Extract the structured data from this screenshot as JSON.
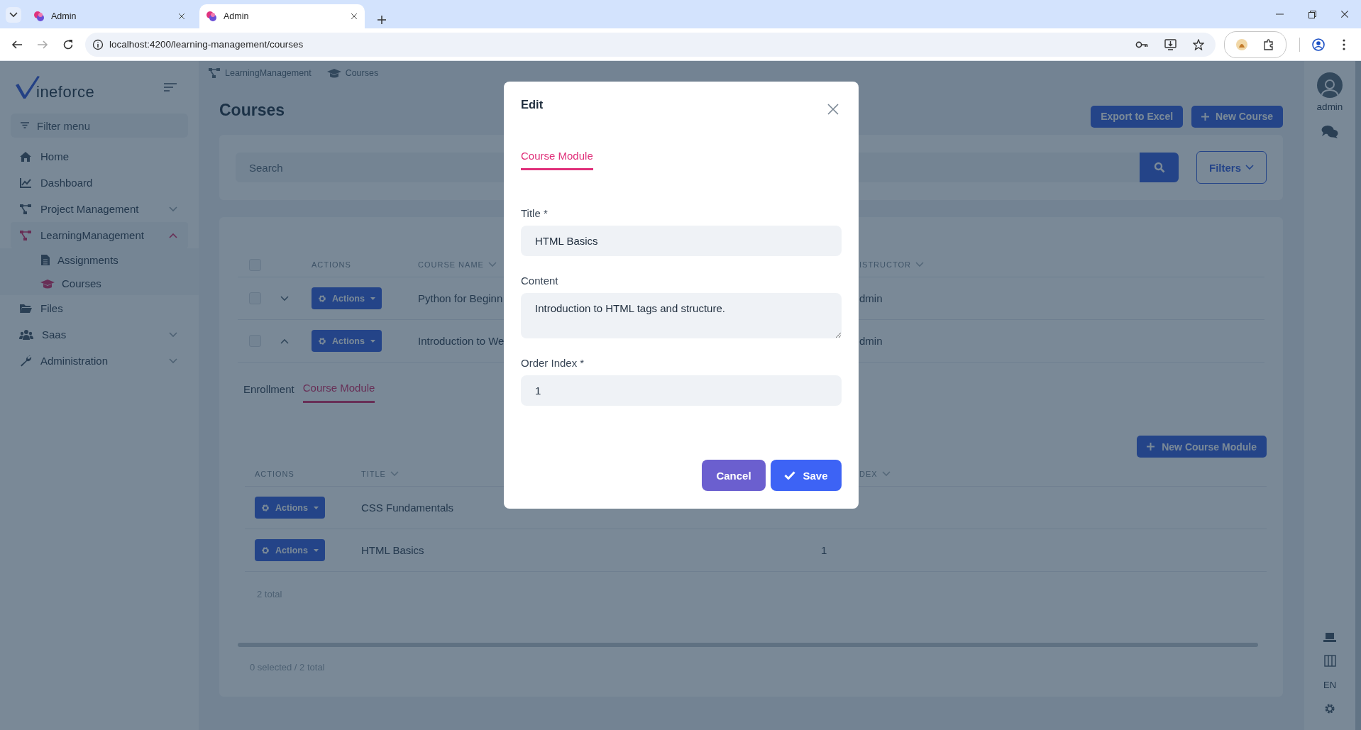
{
  "browser": {
    "tabs": [
      {
        "title": "Admin",
        "selected": false
      },
      {
        "title": "Admin",
        "selected": true
      }
    ],
    "url": "localhost:4200/learning-management/courses"
  },
  "sidebar": {
    "logo": "ineforce",
    "filter_placeholder": "Filter menu",
    "items": [
      {
        "label": "Home",
        "selected": false
      },
      {
        "label": "Dashboard",
        "selected": false
      },
      {
        "label": "Project Management",
        "selected": false,
        "expanded": false
      },
      {
        "label": "LearningManagement",
        "selected": true,
        "expanded": true,
        "children": [
          {
            "label": "Assignments",
            "selected": false
          },
          {
            "label": "Courses",
            "selected": true
          }
        ]
      },
      {
        "label": "Files",
        "selected": false
      },
      {
        "label": "Saas",
        "selected": false,
        "expanded": false
      },
      {
        "label": "Administration",
        "selected": false,
        "expanded": false
      }
    ]
  },
  "main": {
    "breadcrumb": [
      "LearningManagement",
      "Courses"
    ],
    "title": "Courses",
    "header_buttons": [
      {
        "label": "Export to Excel",
        "kind": "plain"
      },
      {
        "label": "New Course",
        "kind": "add"
      }
    ],
    "search": {
      "placeholder": "Search"
    },
    "filters_button": "Filters",
    "table": {
      "select_all_checked": false,
      "columns": [
        "ACTIONS",
        "COURSE NAME",
        "ISTRUCTOR"
      ],
      "rows": [
        {
          "checked": false,
          "expanded": false,
          "action": "Actions",
          "course_name": "Python for Beginn",
          "instructor": "dmin"
        },
        {
          "checked": false,
          "expanded": true,
          "action": "Actions",
          "course_name": "Introduction to We",
          "instructor": "dmin"
        }
      ]
    },
    "detail": {
      "tabs": [
        {
          "label": "Enrollment",
          "selected": false
        },
        {
          "label": "Course Module",
          "selected": true
        }
      ],
      "new_button": "New Course Module",
      "columns": [
        "ACTIONS",
        "TITLE",
        "DEX"
      ],
      "rows": [
        {
          "action": "Actions",
          "title": "CSS Fundamentals"
        },
        {
          "action": "Actions",
          "title": "HTML Basics",
          "order_index": "1"
        }
      ],
      "total": "2 total"
    },
    "footer": "0 selected / 2 total"
  },
  "right_rail": {
    "user": "admin",
    "language": "EN"
  },
  "modal": {
    "title": "Edit",
    "tabs": [
      {
        "label": "Course Module",
        "selected": true
      }
    ],
    "fields": [
      {
        "label": "Title *",
        "kind": "input",
        "value": "HTML Basics"
      },
      {
        "label": "Content",
        "kind": "textarea",
        "value": "Introduction to HTML tags and structure."
      },
      {
        "label": "Order Index *",
        "kind": "input",
        "value": "1"
      }
    ],
    "buttons": [
      {
        "label": "Cancel",
        "kind": "secondary"
      },
      {
        "label": "Save",
        "kind": "primary"
      }
    ]
  }
}
